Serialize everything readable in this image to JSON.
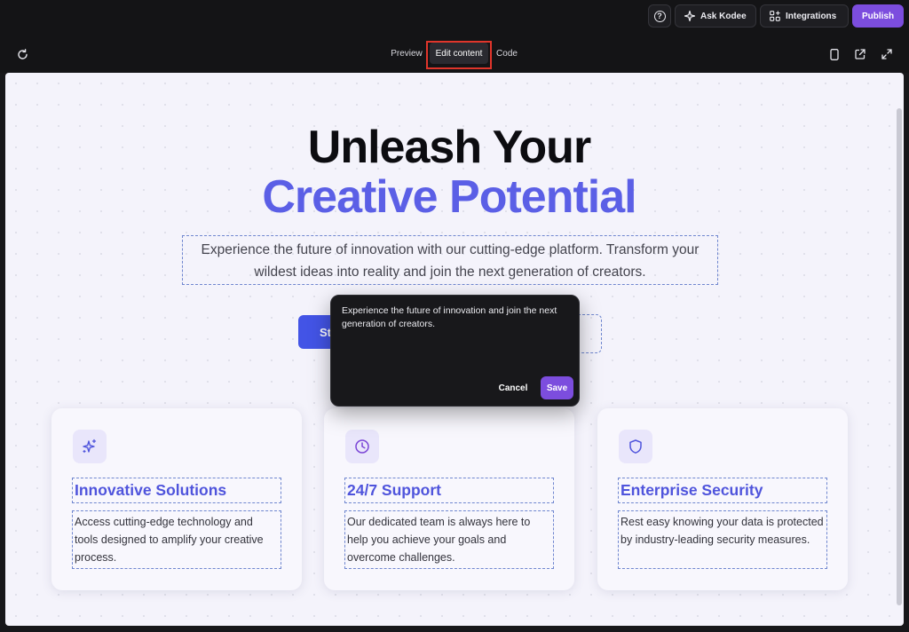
{
  "topbar": {
    "help_icon": "question-circle-icon",
    "ask_label": "Ask Kodee",
    "ask_icon": "sparkle-icon",
    "integrations_label": "Integrations",
    "integrations_icon": "apps-plus-icon",
    "publish_label": "Publish"
  },
  "toolbar": {
    "refresh_icon": "refresh-icon",
    "tabs": [
      {
        "label": "Preview"
      },
      {
        "label": "Edit content",
        "active": true
      },
      {
        "label": "Code"
      }
    ],
    "right_icons": [
      "mobile-device-icon",
      "open-external-icon",
      "expand-icon"
    ]
  },
  "hero": {
    "title_line1": "Unleash Your",
    "title_line2": "Creative Potential",
    "subtitle": "Experience the future of innovation with our cutting-edge platform. Transform your wildest ideas into reality and join the next generation of creators.",
    "cta_primary_visible": "St"
  },
  "features": [
    {
      "icon": "sparkles-icon",
      "title": "Innovative Solutions",
      "body": "Access cutting-edge technology and tools designed to amplify your creative process."
    },
    {
      "icon": "clock-icon",
      "title": "24/7 Support",
      "body": "Our dedicated team is always here to help you achieve your goals and overcome challenges."
    },
    {
      "icon": "shield-icon",
      "title": "Enterprise Security",
      "body": "Rest easy knowing your data is protected by industry-leading security measures."
    }
  ],
  "popover": {
    "text": "Experience the future of innovation and join the next generation of creators.",
    "cancel_label": "Cancel",
    "save_label": "Save"
  },
  "colors": {
    "accent": "#7c4dde",
    "brand_blue": "#5b5fe6",
    "button_blue": "#4354e6",
    "highlight": "#e0352b"
  }
}
